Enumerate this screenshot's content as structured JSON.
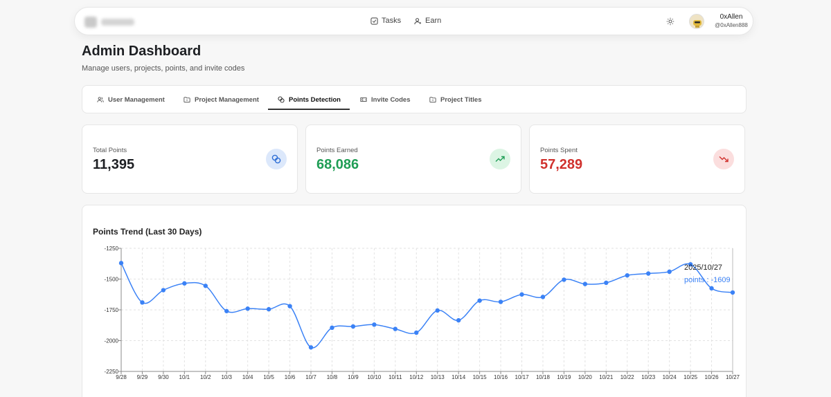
{
  "nav": {
    "links": [
      {
        "label": "Tasks",
        "icon": "square-check-icon"
      },
      {
        "label": "Earn",
        "icon": "user-plus-icon"
      }
    ],
    "user": {
      "name": "0xAllen",
      "handle": "@0xAllen888"
    }
  },
  "header": {
    "title": "Admin Dashboard",
    "subtitle": "Manage users, projects, points, and invite codes"
  },
  "tabs": [
    {
      "label": "User Management",
      "icon": "users-icon",
      "active": false
    },
    {
      "label": "Project Management",
      "icon": "folder-icon",
      "active": false
    },
    {
      "label": "Points Detection",
      "icon": "coins-icon",
      "active": true
    },
    {
      "label": "Invite Codes",
      "icon": "ticket-icon",
      "active": false
    },
    {
      "label": "Project Titles",
      "icon": "folder-icon",
      "active": false
    }
  ],
  "stats": [
    {
      "label": "Total Points",
      "value": "11,395",
      "color": "#1d1f23",
      "icon": "coins-icon",
      "icon_bg": "#dce8fb",
      "icon_color": "#2f6fd6"
    },
    {
      "label": "Points Earned",
      "value": "68,086",
      "color": "#1f9d55",
      "icon": "trending-up-icon",
      "icon_bg": "#dcf5e4",
      "icon_color": "#1f9d55"
    },
    {
      "label": "Points Spent",
      "value": "57,289",
      "color": "#d0312d",
      "icon": "trending-down-icon",
      "icon_bg": "#fbdede",
      "icon_color": "#d0312d"
    }
  ],
  "chart_title": "Points Trend (Last 30 Days)",
  "chart_data": {
    "type": "line",
    "x": [
      "9/28",
      "9/29",
      "9/30",
      "10/1",
      "10/2",
      "10/3",
      "10/4",
      "10/5",
      "10/6",
      "10/7",
      "10/8",
      "10/9",
      "10/10",
      "10/11",
      "10/12",
      "10/13",
      "10/14",
      "10/15",
      "10/16",
      "10/17",
      "10/18",
      "10/19",
      "10/20",
      "10/21",
      "10/22",
      "10/23",
      "10/24",
      "10/25",
      "10/26",
      "10/27"
    ],
    "series": [
      {
        "name": "points",
        "color": "#3b82f6",
        "values": [
          -1370,
          -1690,
          -1590,
          -1535,
          -1555,
          -1760,
          -1740,
          -1745,
          -1720,
          -2055,
          -1895,
          -1885,
          -1870,
          -1905,
          -1935,
          -1755,
          -1835,
          -1675,
          -1685,
          -1625,
          -1645,
          -1505,
          -1540,
          -1530,
          -1470,
          -1455,
          -1440,
          -1380,
          -1575,
          -1609
        ]
      }
    ],
    "ylim": [
      -2250,
      -1250
    ],
    "yticks": [
      -1250,
      -1500,
      -1750,
      -2000,
      -2250
    ],
    "grid": true,
    "tooltip": {
      "title": "2025/10/27",
      "label": "points :",
      "value": "-1609"
    }
  }
}
